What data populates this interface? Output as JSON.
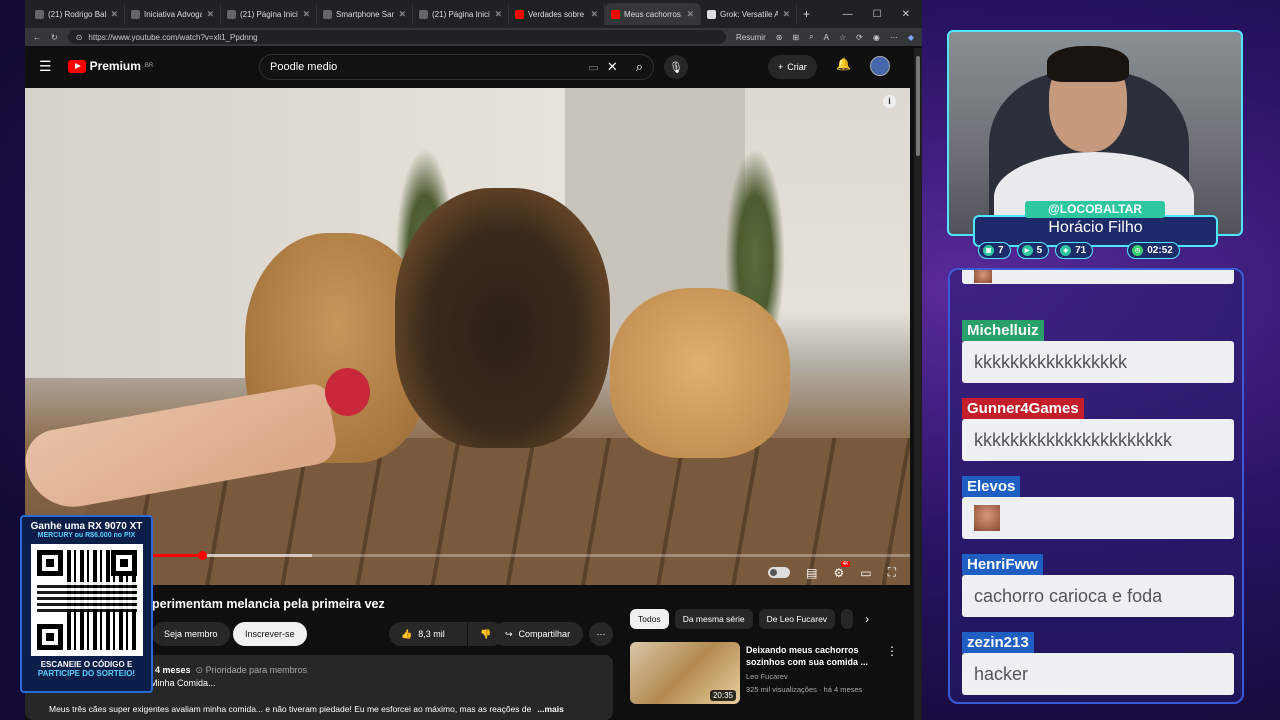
{
  "browser": {
    "tabs": [
      {
        "label": "(21) Rodrigo Baltar",
        "icon": "x-icon"
      },
      {
        "label": "Iniciativa Advogados",
        "icon": "globe-icon"
      },
      {
        "label": "(21) Página Inicial",
        "icon": "x-icon"
      },
      {
        "label": "Smartphone Samsung",
        "icon": "page-icon"
      },
      {
        "label": "(21) Página Inicial",
        "icon": "x-icon"
      },
      {
        "label": "Verdades sobre IA",
        "icon": "youtube-icon"
      },
      {
        "label": "Meus cachorros e",
        "icon": "youtube-icon"
      },
      {
        "label": "Grok: Versatile AI",
        "icon": "grok-icon"
      }
    ],
    "url": "https://www.youtube.com/watch?v=xli1_Ppdnng",
    "resume_label": "Resumir"
  },
  "youtube": {
    "logo": "Premium",
    "region": "BR",
    "search_value": "Poodle medio",
    "create_label": "Criar"
  },
  "player": {
    "progress_fraction": 0.2,
    "buffer_fraction": 0.24,
    "hd_badge": "4K"
  },
  "video": {
    "title": "perimentam melancia pela primeira vez",
    "member_label": "Seja membro",
    "subscribe_label": "Inscrever-se",
    "likes": "8,3 mil",
    "share_label": "Compartilhar",
    "age": "4 meses",
    "priority": "Prioridade para membros",
    "desc_line2": "Minha Comida...",
    "description": "Meus três cães super exigentes avaliam minha comida... e não tiveram piedade! Eu me esforcei ao máximo, mas as reações de",
    "more_label": "...mais"
  },
  "chips": [
    "Todos",
    "Da mesma série",
    "De Leo Fucarev"
  ],
  "recommendation": {
    "title": "Deixando meus cachorros sozinhos com sua comida ...",
    "channel": "Leo Fucarev",
    "views": "325 mil visualizações · há 4 meses",
    "duration": "20:35"
  },
  "promo": {
    "line1": "Ganhe uma RX 9070 XT",
    "line2": "MERCURY ou R$6.000 no PIX",
    "line3": "ESCANEIE O CÓDIGO E",
    "line4": "PARTICIPE DO SORTEIO!"
  },
  "streamer": {
    "handle": "@LOCOBALTAR",
    "name": "Horácio Filho",
    "stats": [
      {
        "icon": "chat-icon",
        "value": "7"
      },
      {
        "icon": "youtube-icon",
        "value": "5"
      },
      {
        "icon": "ticket-icon",
        "value": "71"
      }
    ],
    "timer": "02:52"
  },
  "chat": [
    {
      "user": "Michelluiz",
      "color": "#27a06a",
      "text": "kkkkkkkkkkkkkkkkk"
    },
    {
      "user": "Gunner4Games",
      "color": "#c41e2a",
      "text": "kkkkkkkkkkkkkkkkkkkkkk"
    },
    {
      "user": "Elevos",
      "color": "#1f5fc4",
      "text": ""
    },
    {
      "user": "HenriFww",
      "color": "#1f5fc4",
      "text": "cachorro carioca e foda"
    },
    {
      "user": "zezin213",
      "color": "#1f5fc4",
      "text": "hacker"
    }
  ]
}
